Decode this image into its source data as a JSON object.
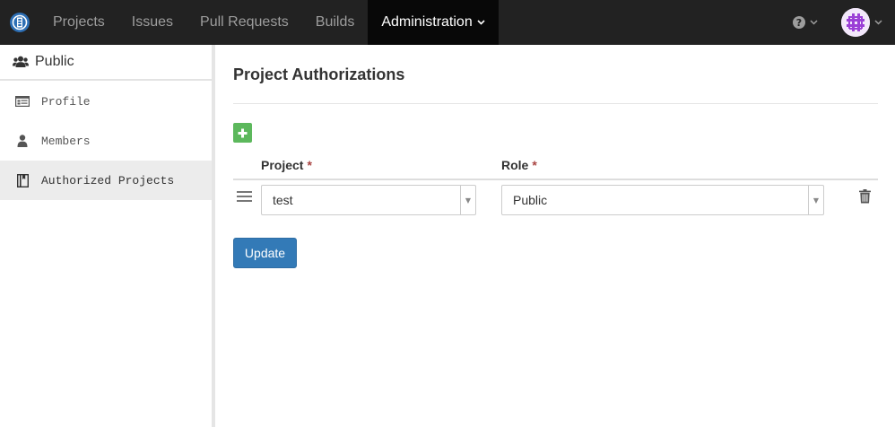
{
  "navbar": {
    "items": [
      {
        "label": "Projects"
      },
      {
        "label": "Issues"
      },
      {
        "label": "Pull Requests"
      },
      {
        "label": "Builds"
      },
      {
        "label": "Administration"
      }
    ],
    "active_index": 4
  },
  "sidebar": {
    "header": "Public",
    "items": [
      {
        "label": "Profile",
        "icon": "id-card-icon"
      },
      {
        "label": "Members",
        "icon": "user-icon"
      },
      {
        "label": "Authorized Projects",
        "icon": "book-icon"
      }
    ],
    "active_index": 2
  },
  "main": {
    "title": "Project Authorizations",
    "columns": {
      "project": "Project",
      "role": "Role",
      "required_mark": "*"
    },
    "rows": [
      {
        "project": "test",
        "role": "Public"
      }
    ],
    "update_label": "Update"
  },
  "colors": {
    "navbar_bg": "#222222",
    "active_nav_bg": "#080808",
    "add_button": "#5cb85c",
    "primary_button": "#337ab7",
    "required": "#a94442"
  }
}
